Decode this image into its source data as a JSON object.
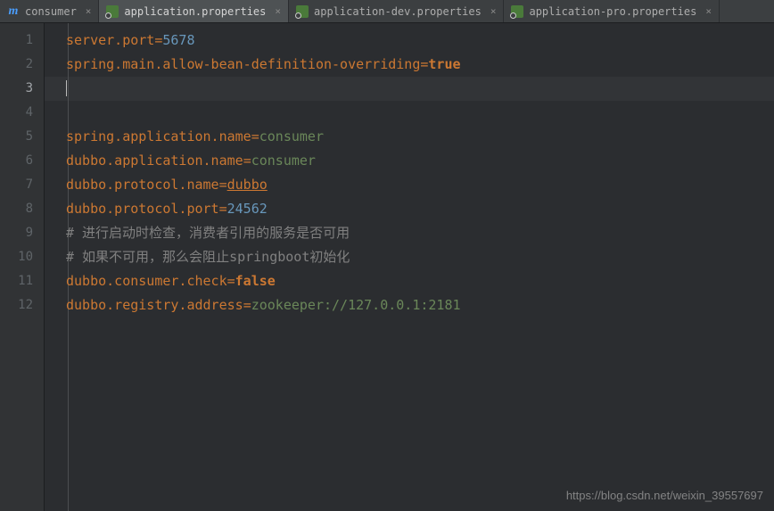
{
  "tabs": [
    {
      "label": "consumer",
      "icon": "m"
    },
    {
      "label": "application.properties",
      "icon": "props",
      "active": true
    },
    {
      "label": "application-dev.properties",
      "icon": "props"
    },
    {
      "label": "application-pro.properties",
      "icon": "props"
    }
  ],
  "gutter": [
    "1",
    "2",
    "3",
    "4",
    "5",
    "6",
    "7",
    "8",
    "9",
    "10",
    "11",
    "12"
  ],
  "code": {
    "l1": {
      "key": "server.port",
      "eq": "=",
      "val": "5678"
    },
    "l2": {
      "key": "spring.main.allow-bean-definition-overriding",
      "eq": "=",
      "val": "true"
    },
    "l5": {
      "key": "spring.application.name",
      "eq": "=",
      "val": "consumer"
    },
    "l6": {
      "key": "dubbo.application.name",
      "eq": "=",
      "val": "consumer"
    },
    "l7": {
      "key": "dubbo.protocol.name",
      "eq": "=",
      "val": "dubbo"
    },
    "l8": {
      "key": "dubbo.protocol.port",
      "eq": "=",
      "val": "24562"
    },
    "l9": {
      "comment": "# 进行启动时检查，消费者引用的服务是否可用"
    },
    "l10": {
      "comment": "# 如果不可用，那么会阻止springboot初始化"
    },
    "l11": {
      "key": "dubbo.consumer.check",
      "eq": "=",
      "val": "false"
    },
    "l12": {
      "key": "dubbo.registry.address",
      "eq": "=",
      "val": "zookeeper://127.0.0.1:2181"
    }
  },
  "watermark": "https://blog.csdn.net/weixin_39557697"
}
